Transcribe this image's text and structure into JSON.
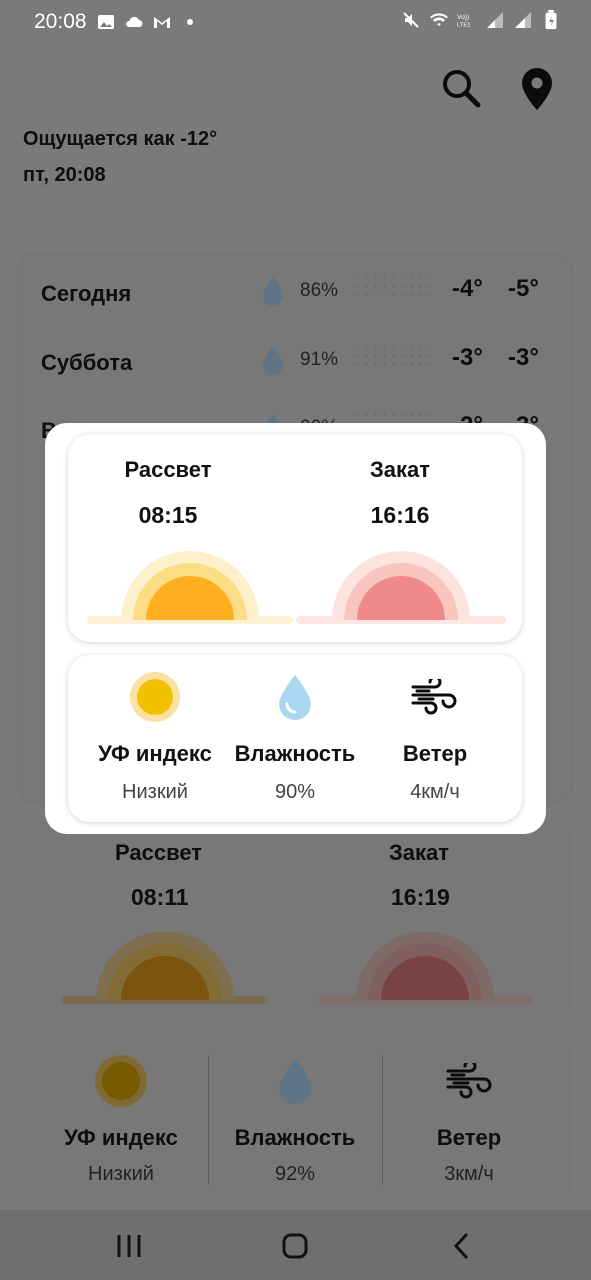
{
  "status_bar": {
    "time": "20:08",
    "left_icons": [
      "image-icon",
      "cloud-icon",
      "gmail-icon",
      "dot-icon"
    ],
    "right_icons": [
      "mute-icon",
      "wifi-icon",
      "volte-icon",
      "signal-icon",
      "signal-icon",
      "battery-icon"
    ]
  },
  "header": {
    "feels_like": "Ощущается как -12°",
    "date": "пт, 20:08",
    "actions": [
      "search-icon",
      "location-pin-icon"
    ]
  },
  "forecast": {
    "days": [
      {
        "day": "Сегодня",
        "humidity": "86%",
        "high": "-4°",
        "low": "-5°"
      },
      {
        "day": "Суббота",
        "humidity": "91%",
        "high": "-3°",
        "low": "-3°"
      },
      {
        "day": "Воскресенье",
        "humidity": "90%",
        "high": "-2°",
        "low": "-3°"
      }
    ]
  },
  "background_sun": {
    "sunrise_label": "Рассвет",
    "sunrise_time": "08:11",
    "sunset_label": "Закат",
    "sunset_time": "16:19"
  },
  "background_metrics": {
    "uv_label": "УФ индекс",
    "uv_value": "Низкий",
    "humidity_label": "Влажность",
    "humidity_value": "92%",
    "wind_label": "Ветер",
    "wind_value": "3км/ч"
  },
  "modal": {
    "sunrise_label": "Рассвет",
    "sunrise_time": "08:15",
    "sunset_label": "Закат",
    "sunset_time": "16:16",
    "uv_label": "УФ индекс",
    "uv_value": "Низкий",
    "humidity_label": "Влажность",
    "humidity_value": "90%",
    "wind_label": "Ветер",
    "wind_value": "4км/ч"
  },
  "colors": {
    "sun": "#FFAE1F",
    "sunset": "#F08A8A",
    "uv": "#F2C200",
    "drop": "#A9D7F2",
    "dim": "#7a7a7a"
  },
  "nav": [
    "recents-icon",
    "home-icon",
    "back-icon"
  ]
}
